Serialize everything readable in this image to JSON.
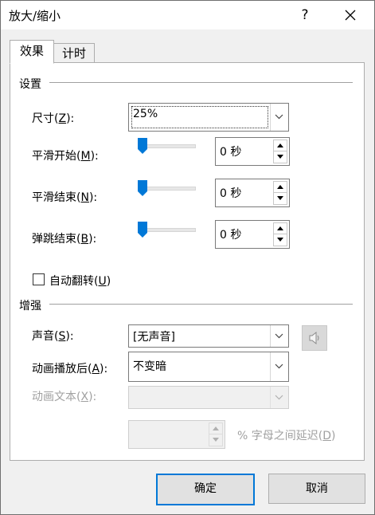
{
  "window": {
    "title": "放大/缩小",
    "help": "?",
    "close_icon": "close-icon"
  },
  "tabs": [
    {
      "label": "效果"
    },
    {
      "label": "计时"
    }
  ],
  "settings": {
    "section_title": "设置",
    "size": {
      "label_pre": "尺寸(",
      "key": "Z",
      "label_post": "):",
      "value": "25%"
    },
    "smooth_start": {
      "label_pre": "平滑开始(",
      "key": "M",
      "label_post": "):",
      "slider_fraction": 0,
      "value": "0 秒"
    },
    "smooth_end": {
      "label_pre": "平滑结束(",
      "key": "N",
      "label_post": "):",
      "slider_fraction": 0,
      "value": "0 秒"
    },
    "bounce_end": {
      "label_pre": "弹跳结束(",
      "key": "B",
      "label_post": "):",
      "slider_fraction": 0,
      "value": "0 秒"
    },
    "auto_reverse": {
      "label_pre": "自动翻转(",
      "key": "U",
      "label_post": ")",
      "checked": false
    }
  },
  "enhancements": {
    "section_title": "增强",
    "sound": {
      "label_pre": "声音(",
      "key": "S",
      "label_post": "):",
      "value": "[无声音]",
      "icon": "speaker-icon"
    },
    "after_animation": {
      "label_pre": "动画播放后(",
      "key": "A",
      "label_post": "):",
      "value": "不变暗"
    },
    "animate_text": {
      "label_pre": "动画文本(",
      "key": "X",
      "label_post": "):",
      "value": ""
    },
    "delay": {
      "value": "",
      "label_pre": "% 字母之间延迟(",
      "key": "D",
      "label_post": ")"
    }
  },
  "buttons": {
    "ok": "确定",
    "cancel": "取消"
  },
  "colors": {
    "accent": "#0078d7",
    "background": "#f0f0f0",
    "panel": "#ffffff"
  }
}
